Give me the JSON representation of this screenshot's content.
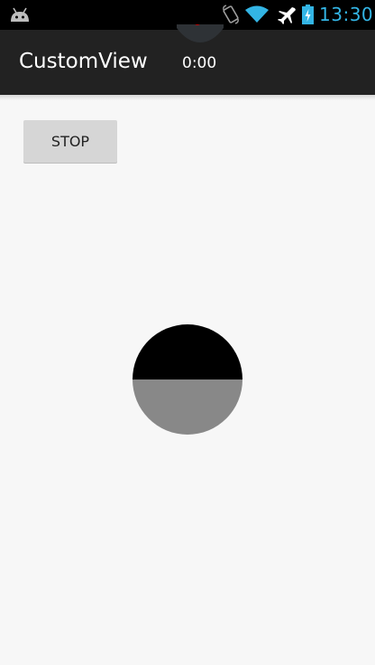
{
  "status_bar": {
    "time": "13:30",
    "icons": [
      "android-icon",
      "screen-rotate-icon",
      "wifi-icon",
      "airplane-mode-icon",
      "battery-charging-icon"
    ],
    "accent_color": "#33b5e5"
  },
  "action_bar": {
    "title": "CustomView",
    "timer": "0:00"
  },
  "content": {
    "button_label": "STOP",
    "circle": {
      "top_color": "#000000",
      "bottom_color": "#888888",
      "filled_fraction": 0.5
    }
  }
}
